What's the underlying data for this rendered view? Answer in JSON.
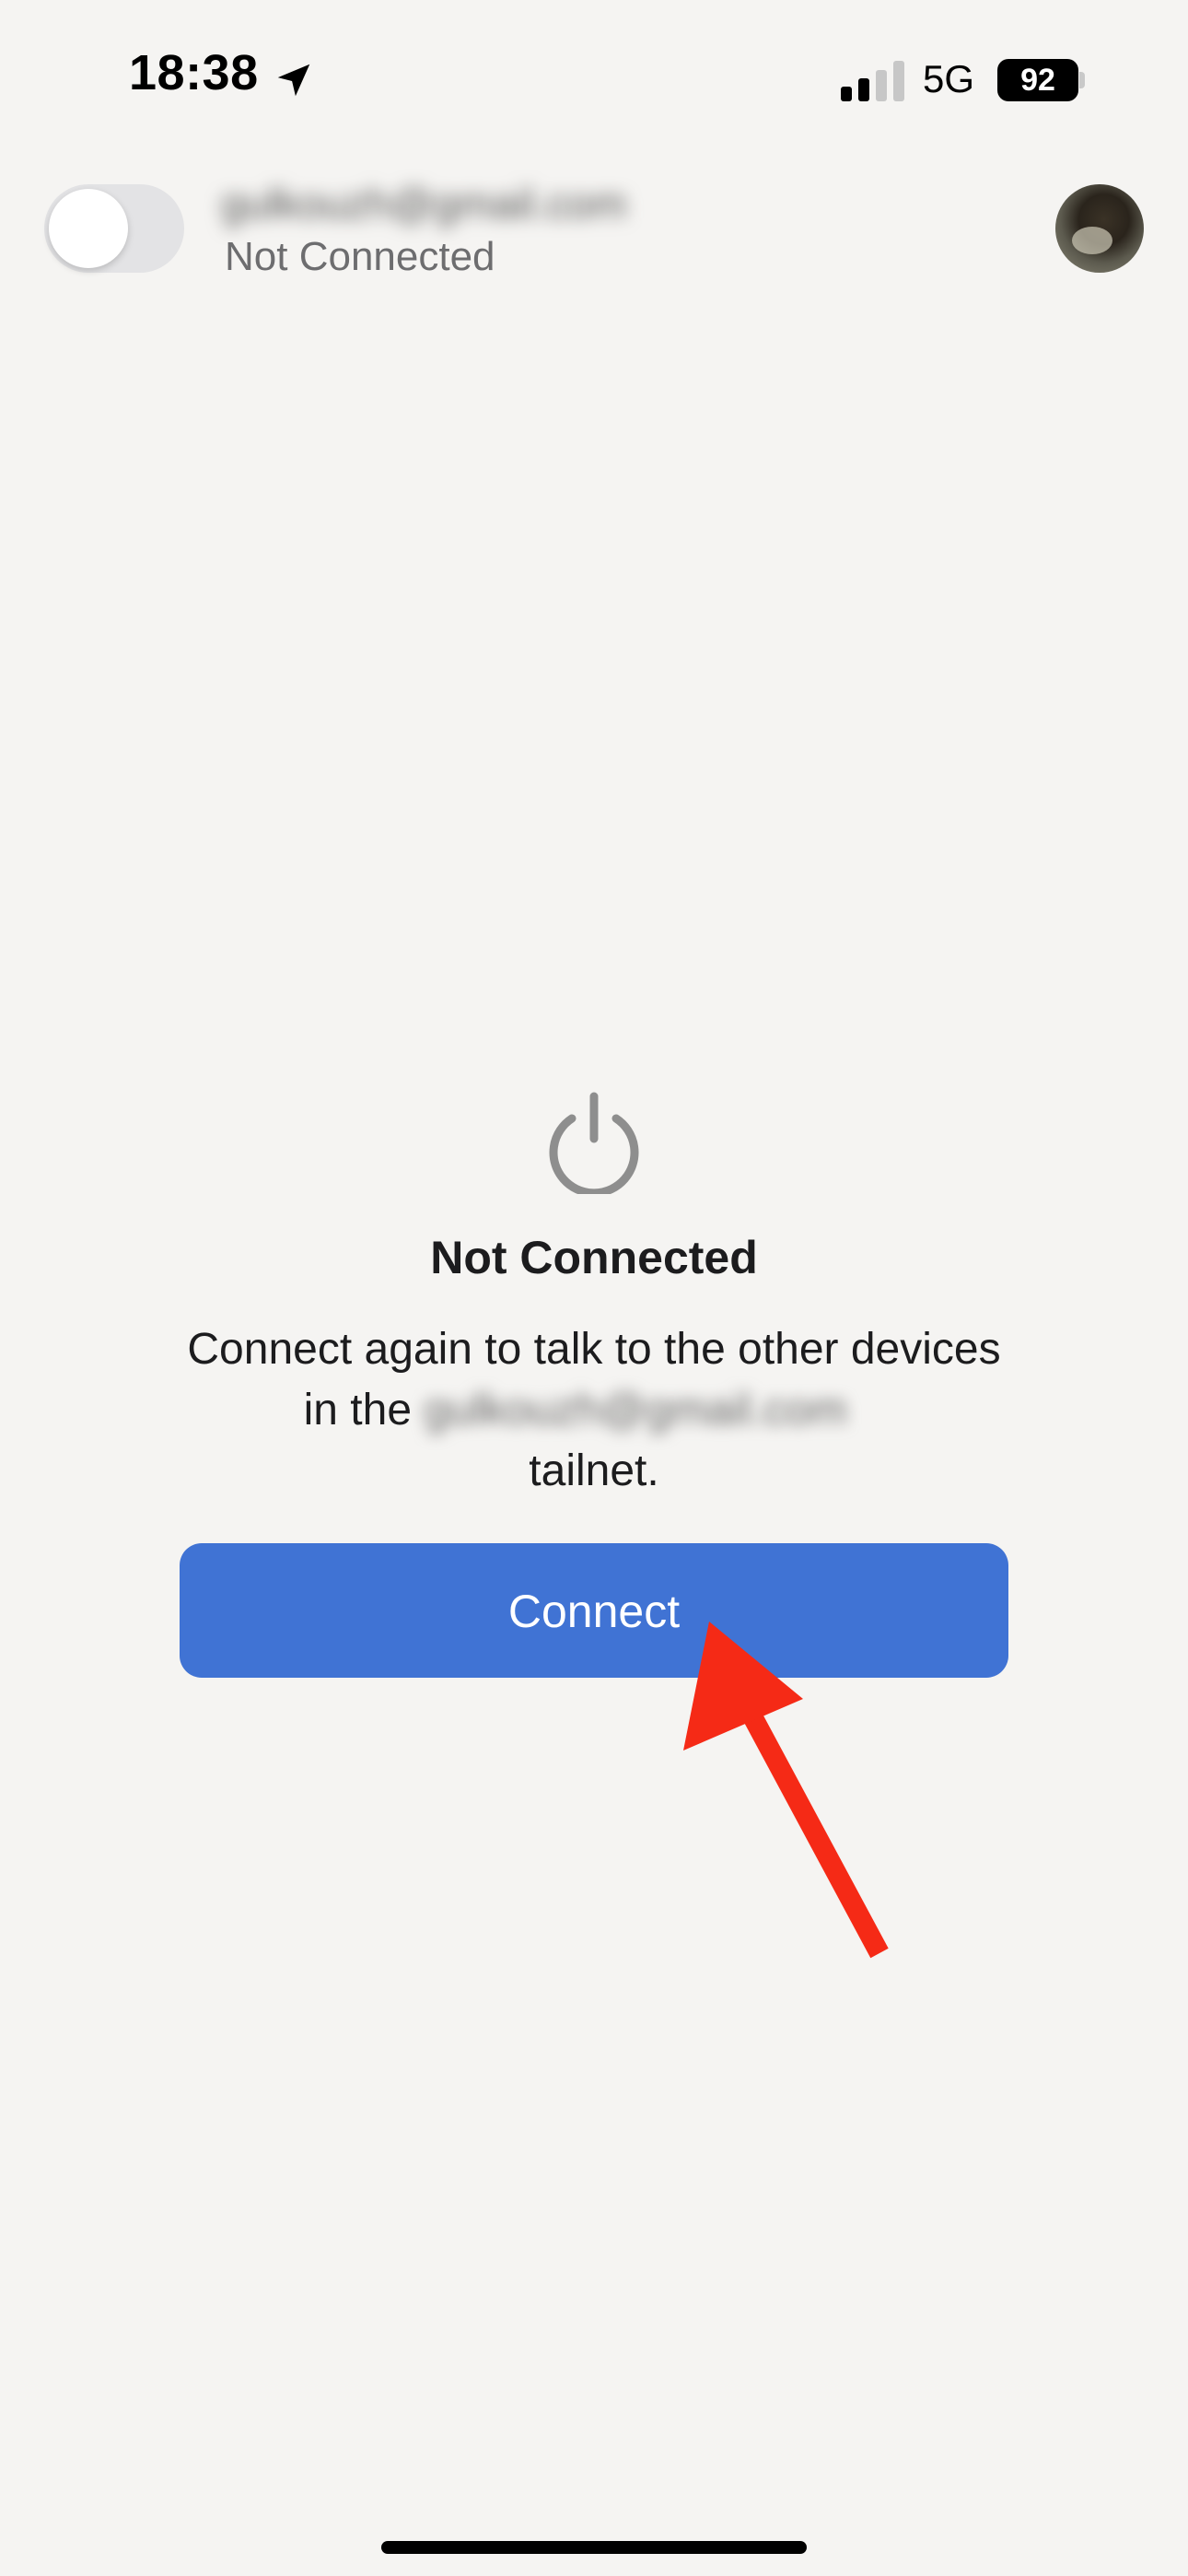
{
  "status_bar": {
    "time": "18:38",
    "network": "5G",
    "battery": "92",
    "icons": [
      "location-arrow-icon",
      "cellular-signal-icon",
      "battery-icon"
    ]
  },
  "header": {
    "vpn_toggle_on": false,
    "account_email": "gulkouzh@gmail.com",
    "account_status": "Not Connected"
  },
  "main": {
    "icon": "power-icon",
    "title": "Not Connected",
    "description_prefix": "Connect again to talk to the other devices in the",
    "tailnet_name": "gulkouzh@gmail.com",
    "description_suffix": "tailnet.",
    "connect_label": "Connect"
  },
  "colors": {
    "background": "#f5f4f2",
    "primary_button": "#4073d4",
    "annotation_arrow": "#f52a16",
    "power_icon": "#8e8e8e"
  }
}
